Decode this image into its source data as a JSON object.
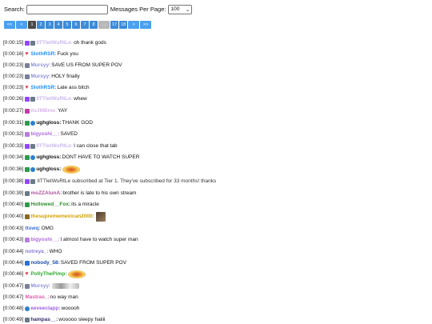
{
  "toolbar": {
    "search_label": "Search:",
    "search_value": "",
    "per_page_label": "Messages Per Page:",
    "per_page_value": "100"
  },
  "pager": {
    "first": "<<",
    "prev": "<",
    "pages": [
      "1",
      "2",
      "3",
      "4",
      "5",
      "6",
      "7",
      "8",
      "...",
      "17",
      "18"
    ],
    "active": "1",
    "next": ">",
    "last": ">>"
  },
  "colors": {
    "pager_blue": "#3d8bd9",
    "pager_active": "#4a4a4a"
  },
  "messages": [
    {
      "ts": "[0:00:15]",
      "badges": [
        "sub",
        "img"
      ],
      "user": "IITTletWuRtLe",
      "user_color": "#c9b8ee",
      "sep": ":",
      "text": "oh thank gods"
    },
    {
      "ts": "[0:00:16]",
      "badges": [
        "heart"
      ],
      "user": "SlothRSR",
      "user_color": "#1e90ff",
      "sep": ":",
      "text": "Fuck you"
    },
    {
      "ts": "[0:00:23]",
      "badges": [
        "gray"
      ],
      "user": "Mursyy",
      "user_color": "#8a8fd6",
      "sep": ":",
      "text": "SAVE US FROM SUPER POV"
    },
    {
      "ts": "[0:00:23]",
      "badges": [
        "gray"
      ],
      "user": "Mursyy",
      "user_color": "#8a8fd6",
      "sep": ":",
      "text": "HOLY finally"
    },
    {
      "ts": "[0:00:23]",
      "badges": [
        "heart"
      ],
      "user": "SlothRSR",
      "user_color": "#1e90ff",
      "sep": ":",
      "text": "Late ass bitch"
    },
    {
      "ts": "[0:00:26]",
      "badges": [
        "sub",
        "img"
      ],
      "user": "IITTletWuRtLe",
      "user_color": "#c9b8ee",
      "sep": ":",
      "text": "whew"
    },
    {
      "ts": "[0:00:27]",
      "badges": [
        "pink"
      ],
      "user": "itsJMBme",
      "user_color": "#d9b8ec",
      "sep": ":",
      "text": "YAY"
    },
    {
      "ts": "[0:00:31]",
      "badges": [
        "green",
        "wave"
      ],
      "user": "ughgloss",
      "user_color": "#111111",
      "sep": ":",
      "text": "THANK GOD"
    },
    {
      "ts": "[0:00:32]",
      "badges": [
        "lav"
      ],
      "user": "bigyoshi__",
      "user_color": "#b06adf",
      "sep": ":",
      "text": "SAVED"
    },
    {
      "ts": "[0:00:33]",
      "badges": [
        "sub",
        "img"
      ],
      "user": "IITTletWuRtLe",
      "user_color": "#c9b8ee",
      "sep": ":",
      "text": "I can close that tab"
    },
    {
      "ts": "[0:00:34]",
      "badges": [
        "green",
        "wave"
      ],
      "user": "ughgloss",
      "user_color": "#111111",
      "sep": ":",
      "text": "DONT HAVE TO WATCH SUPER"
    },
    {
      "ts": "[0:00:36]",
      "badges": [
        "green",
        "wave"
      ],
      "user": "ughgloss",
      "user_color": "#111111",
      "sep": ":",
      "text": "",
      "emote": "disc"
    },
    {
      "ts": "[0:00:38]",
      "badges": [
        "sub",
        "img"
      ],
      "user": "",
      "user_color": "#c9b8ee",
      "sep": "",
      "text": "IITTletWuRtLe subscribed at Tier 1. They've subscribed for 33 months! thanks"
    },
    {
      "ts": "[0:00:39]",
      "badges": [
        "img"
      ],
      "user": "moZZAlunA",
      "user_color": "#b0549f",
      "sep": ":",
      "text": "brother is late to his own stream"
    },
    {
      "ts": "[0:00:40]",
      "badges": [
        "green"
      ],
      "user": "Hollowed__Fox",
      "user_color": "#2e8b2e",
      "sep": ":",
      "text": "its a miracle"
    },
    {
      "ts": "[0:00:40]",
      "badges": [
        "gold"
      ],
      "user": "thesuprememexican2000",
      "user_color": "#d2a000",
      "sep": ":",
      "text": "",
      "emote": "face"
    },
    {
      "ts": "[0:00:43]",
      "badges": [],
      "user": "ttswq",
      "user_color": "#3a6fd8",
      "sep": ":",
      "text": "OMG"
    },
    {
      "ts": "[0:00:43]",
      "badges": [
        "lav"
      ],
      "user": "bigyoshi__",
      "user_color": "#b06adf",
      "sep": ":",
      "text": "I almost have to watch super man"
    },
    {
      "ts": "[0:00:44]",
      "badges": [],
      "user": "notreya_",
      "user_color": "#8a7ad6",
      "sep": ":",
      "text": "WHO"
    },
    {
      "ts": "[0:00:44]",
      "badges": [
        "blue"
      ],
      "user": "nobody_58",
      "user_color": "#1e4fa8",
      "sep": ":",
      "text": "SAVED FROM SUPER POV"
    },
    {
      "ts": "[0:00:46]",
      "badges": [
        "heart"
      ],
      "user": "PollyThePimp",
      "user_color": "#2eaa2e",
      "sep": ":",
      "text": "",
      "emote": "disc"
    },
    {
      "ts": "[0:00:47]",
      "badges": [
        "gray"
      ],
      "user": "Mursyy",
      "user_color": "#8a8fd6",
      "sep": ":",
      "text": "",
      "emote": "blur"
    },
    {
      "ts": "[0:00:47]",
      "badges": [],
      "user": "Mastras_",
      "user_color": "#e05ab0",
      "sep": ":",
      "text": "no way man"
    },
    {
      "ts": "[0:00:48]",
      "badges": [
        "wave"
      ],
      "user": "eeveeclapp",
      "user_color": "#a060e0",
      "sep": ":",
      "text": "wooooh"
    },
    {
      "ts": "[0:00:49]",
      "badges": [
        "img"
      ],
      "user": "hampas__",
      "user_color": "#3a2a6a",
      "sep": ":",
      "text": "wooooo sleepy haiiii"
    },
    {
      "ts": "",
      "badges": [],
      "user": "",
      "user_color": "#111111",
      "sep": "",
      "text": "",
      "emote": "peek"
    }
  ]
}
